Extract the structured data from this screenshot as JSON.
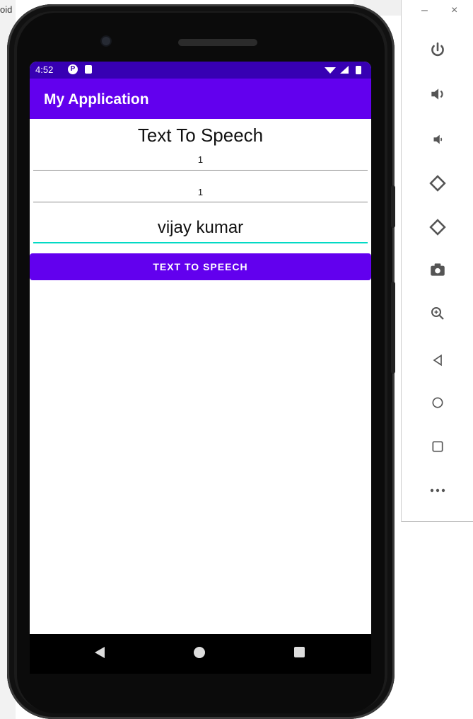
{
  "host": {
    "left_fragment": "oid"
  },
  "device": {
    "status_bar": {
      "time": "4:52",
      "p_icon": "P"
    },
    "app_bar": {
      "title": "My Application"
    },
    "content": {
      "heading": "Text To Speech",
      "field1": {
        "value": "1"
      },
      "field2": {
        "value": "1"
      },
      "field3": {
        "value": "vijay kumar"
      },
      "button": {
        "label": "TEXT TO SPEECH"
      }
    }
  },
  "panel": {
    "controls": [
      "–",
      "×"
    ],
    "icons": [
      "power-icon",
      "volume-up-icon",
      "volume-down-icon",
      "rotate-left-icon",
      "rotate-right-icon",
      "camera-icon",
      "zoom-icon",
      "back-icon",
      "home-icon",
      "overview-icon",
      "more-icon"
    ]
  },
  "colors": {
    "primary": "#6200ee",
    "primary_dark": "#3700b3",
    "accent": "#03dac5"
  }
}
